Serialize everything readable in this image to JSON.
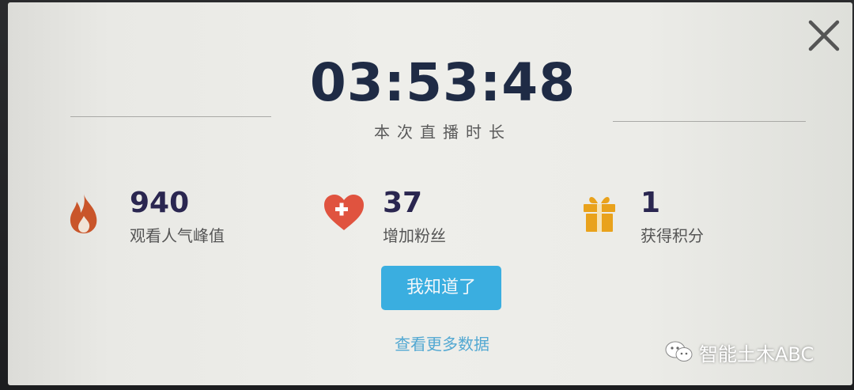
{
  "timer": {
    "value": "03:53:48",
    "label": "本次直播时长"
  },
  "stats": [
    {
      "icon": "flame-icon",
      "value": "940",
      "label": "观看人气峰值",
      "color": "#c9552a"
    },
    {
      "icon": "heart-plus-icon",
      "value": "37",
      "label": "增加粉丝",
      "color": "#e0533f"
    },
    {
      "icon": "gift-icon",
      "value": "1",
      "label": "获得积分",
      "color": "#e9a21c"
    }
  ],
  "actions": {
    "confirm_label": "我知道了",
    "more_data_label": "查看更多数据"
  },
  "watermark": {
    "text": "智能土木ABC",
    "icon": "wechat-icon"
  },
  "colors": {
    "accent": "#3aaee0",
    "link": "#52a8d2",
    "timer_text": "#1f2b45",
    "stat_value": "#2a2650"
  }
}
